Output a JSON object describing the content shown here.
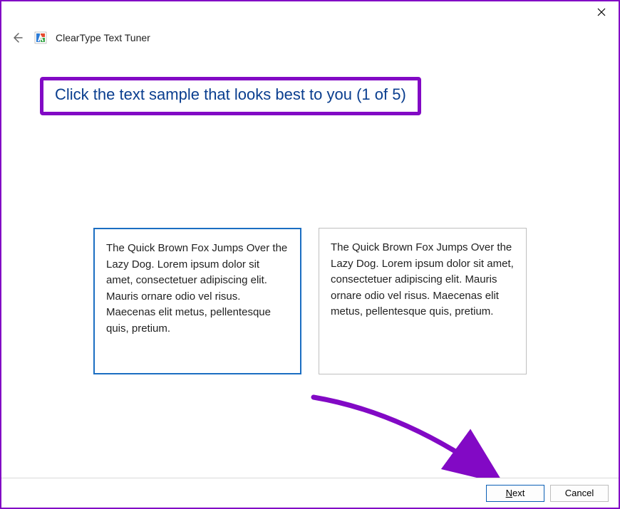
{
  "window": {
    "title": "ClearType Text Tuner"
  },
  "heading": "Click the text sample that looks best to you (1 of 5)",
  "samples": [
    {
      "text": "The Quick Brown Fox Jumps Over the Lazy Dog. Lorem ipsum dolor sit amet, consectetuer adipiscing elit. Mauris ornare odio vel risus. Maecenas elit metus, pellentesque quis, pretium.",
      "selected": true
    },
    {
      "text": "The Quick Brown Fox Jumps Over the Lazy Dog. Lorem ipsum dolor sit amet, consectetuer adipiscing elit. Mauris ornare odio vel risus. Maecenas elit metus, pellentesque quis, pretium.",
      "selected": false
    }
  ],
  "buttons": {
    "next": "Next",
    "cancel": "Cancel"
  },
  "annotation": {
    "highlight_color": "#8209c5"
  }
}
